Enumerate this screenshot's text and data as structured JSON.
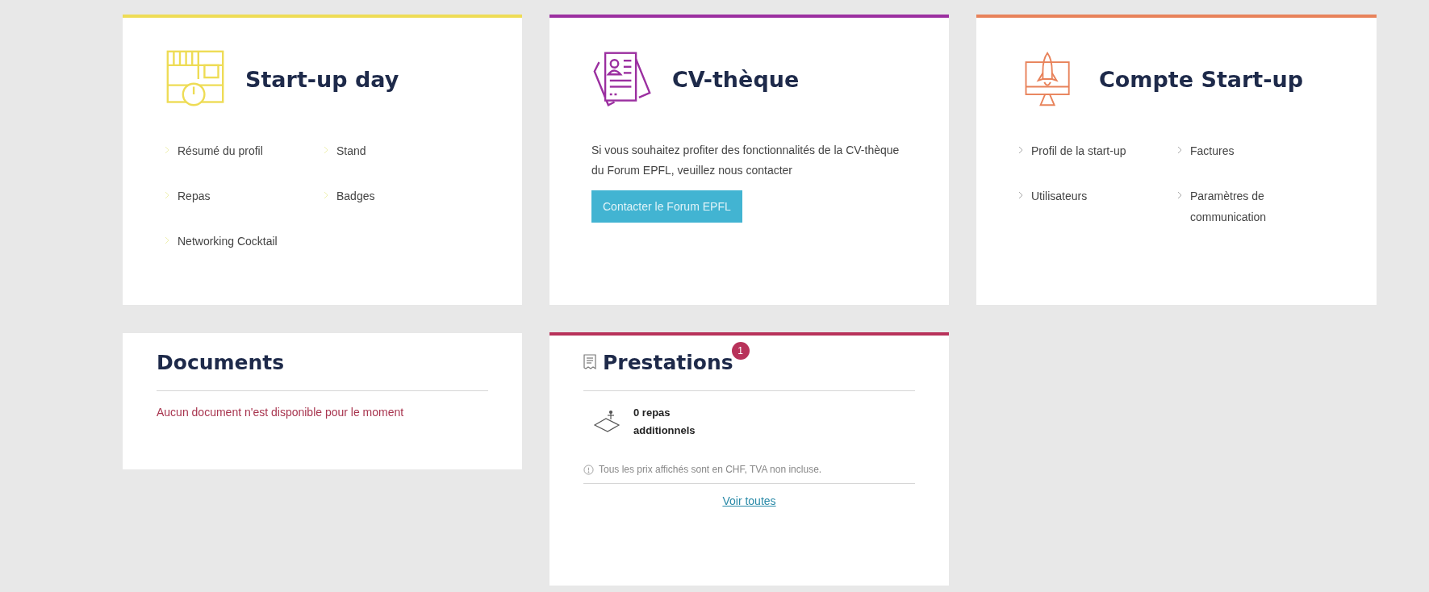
{
  "cards": [
    {
      "kind": "links",
      "title": "Start-up day",
      "color": "#eedc55",
      "links": [
        "Résumé du profil",
        "Stand",
        "Repas",
        "Badges",
        "Networking Cocktail"
      ]
    },
    {
      "kind": "contact",
      "title": "CV-thèque",
      "color": "#9b2fa0",
      "text": "Si vous souhaitez profiter des fonctionnalités de la CV-thèque du Forum EPFL, veuillez nous contacter",
      "button": "Contacter le Forum EPFL"
    },
    {
      "kind": "links",
      "title": "Compte Start-up",
      "color": "#e8825a",
      "links": [
        "Profil de la start-up",
        "Factures",
        "Utilisateurs",
        "Paramètres de communication"
      ]
    }
  ],
  "documents": {
    "title": "Documents",
    "message": "Aucun document n'est disponible pour le moment"
  },
  "prestations": {
    "title": "Prestations",
    "badge": "1",
    "color": "#b8325a",
    "items": [
      {
        "label": "0 repas additionnels"
      }
    ],
    "note": "Tous les prix affichés sont en CHF, TVA non incluse.",
    "link": "Voir toutes"
  }
}
